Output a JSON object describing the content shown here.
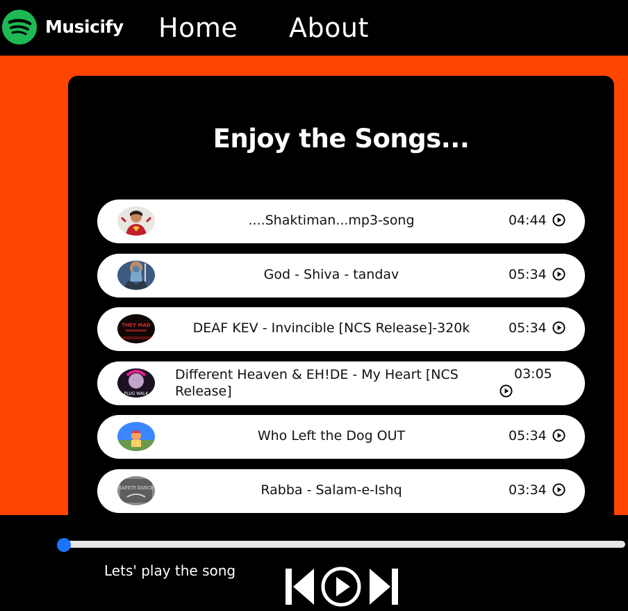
{
  "app": {
    "brand": "Musicify",
    "brand_color": "#1DB954",
    "accent_color": "#ff4500",
    "nav": [
      {
        "label": "Home"
      },
      {
        "label": "About"
      }
    ]
  },
  "main": {
    "heading": "Enjoy the Songs...",
    "songs": [
      {
        "title": "....Shaktiman...mp3-song",
        "duration": "04:44"
      },
      {
        "title": "God - Shiva - tandav",
        "duration": "05:34"
      },
      {
        "title": "DEAF KEV - Invincible [NCS Release]-320k",
        "duration": "05:34"
      },
      {
        "title": "Different Heaven & EH!DE - My Heart [NCS Release]",
        "duration": "03:05"
      },
      {
        "title": "Who Left the Dog OUT",
        "duration": "05:34"
      },
      {
        "title": "Rabba - Salam-e-Ishq",
        "duration": "03:34"
      }
    ],
    "cover_texts": {
      "song3": "THEY MAD",
      "song4": "PLUG WALK",
      "song6": "SAFETY DANCE"
    }
  },
  "player": {
    "status_text": "Lets' play the song",
    "progress": 0,
    "progress_color": "#1a73ff",
    "controls": [
      "previous-icon",
      "play-icon",
      "next-icon"
    ]
  }
}
